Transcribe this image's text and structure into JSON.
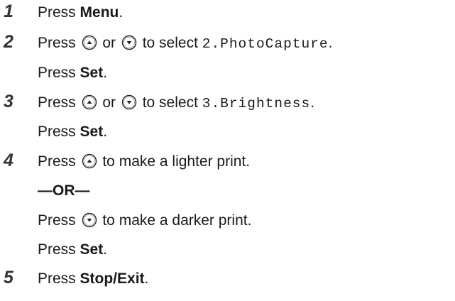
{
  "steps": [
    {
      "number": "1",
      "lines": [
        {
          "text1": "Press ",
          "bold1": "Menu",
          "text2": "."
        }
      ]
    },
    {
      "number": "2",
      "lines": [
        {
          "text1": "Press ",
          "key1": "up-arrow-key",
          "text2": " or ",
          "key2": "down-arrow-key",
          "text3": " to select ",
          "mono": "2.PhotoCapture",
          "text4": "."
        },
        {
          "text1": "Press ",
          "bold1": "Set",
          "text2": "."
        }
      ]
    },
    {
      "number": "3",
      "lines": [
        {
          "text1": "Press ",
          "key1": "up-arrow-key",
          "text2": " or ",
          "key2": "down-arrow-key",
          "text3": " to select ",
          "mono": "3.Brightness",
          "text4": "."
        },
        {
          "text1": "Press ",
          "bold1": "Set",
          "text2": "."
        }
      ]
    },
    {
      "number": "4",
      "lines": [
        {
          "text1": "Press ",
          "key1": "up-arrow-key",
          "text2": " to make a lighter print."
        },
        {
          "separator": "—OR—"
        },
        {
          "text1": "Press ",
          "key1": "down-arrow-key",
          "text2": " to make a darker print."
        },
        {
          "text1": "Press ",
          "bold1": "Set",
          "text2": "."
        }
      ]
    },
    {
      "number": "5",
      "lines": [
        {
          "text1": "Press ",
          "bold1": "Stop/Exit",
          "text2": "."
        }
      ]
    }
  ]
}
